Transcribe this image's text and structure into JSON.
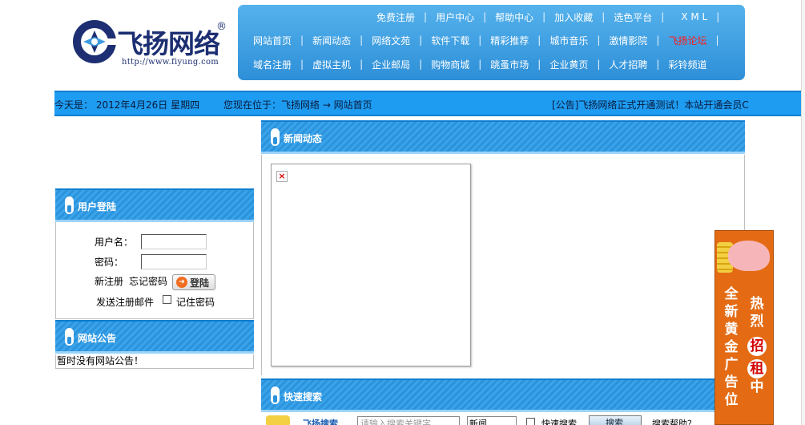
{
  "header": {
    "logo_text": "飞扬网络",
    "logo_registered": "®",
    "logo_url": "http://www.fiyung.com",
    "nav_rows": [
      [
        "免费注册",
        "用户中心",
        "帮助中心",
        "加入收藏",
        "选色平台",
        "X M L"
      ],
      [
        "网站首页",
        "新闻动态",
        "网络文苑",
        "软件下载",
        "精彩推荐",
        "城市音乐",
        "激情影院",
        "飞扬论坛"
      ],
      [
        "域名注册",
        "虚拟主机",
        "企业邮局",
        "购物商城",
        "跳蚤市场",
        "企业黄页",
        "人才招聘",
        "彩铃频道"
      ]
    ],
    "separator": "|",
    "highlight_item": "飞扬论坛"
  },
  "info_bar": {
    "date_text": "今天是： 2012年4月26日  星期四",
    "location_text": "您现在位于：飞扬网络 → 网站首页",
    "announcement_text": "[公告]飞扬网络正式开通测试！本站开通会员C"
  },
  "left": {
    "login_title": "用户登陆",
    "username_label": "用户名：",
    "password_label": "密码：",
    "register_link": "新注册",
    "forgot_link": "忘记密码",
    "login_button": "登陆",
    "send_mail_link": "发送注册邮件",
    "remember_label": "记住密码",
    "notice_title": "网站公告",
    "notice_text": "暂时没有网站公告！"
  },
  "main": {
    "news_title": "新闻动态",
    "search_title": "快速搜索",
    "search_label": "飞扬搜索",
    "search_placeholder": "请输入搜索关键字",
    "search_type": "新闻",
    "fast_search_label": "快速搜索",
    "search_button": "搜索",
    "search_help": "搜索帮助？"
  },
  "ad": {
    "right_col": "热烈",
    "right_circle": "招租",
    "right_end": "中",
    "left_col": "全新黄金广告位"
  },
  "colors": {
    "nav_blue": "#2e8fd8",
    "info_bar": "#1e9cf2",
    "logo_navy": "#1d2f72",
    "highlight_red": "#ff1a1a",
    "ad_orange": "#e46b14"
  }
}
